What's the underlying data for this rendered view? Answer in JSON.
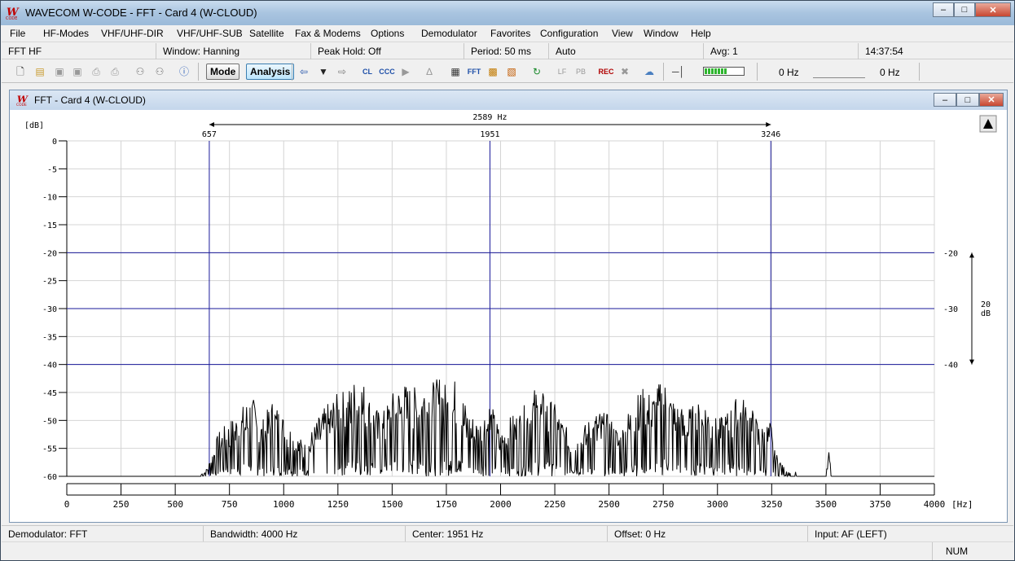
{
  "window": {
    "title": "WAVECOM W-CODE - FFT  - Card 4 (W-CLOUD)",
    "logo_text": "W CODE"
  },
  "menu": [
    "File",
    "HF-Modes",
    "VHF/UHF-DIR",
    "VHF/UHF-SUB",
    "Satellite",
    "Fax & Modems",
    "Options",
    "Demodulator",
    "Favorites",
    "Configuration",
    "View",
    "Window",
    "Help"
  ],
  "infobar": {
    "mode": "FFT HF",
    "window": "Window: Hanning",
    "peak_hold": "Peak Hold: Off",
    "period": "Period: 50 ms",
    "auto": "Auto",
    "avg": "Avg: 1",
    "time": "14:37:54"
  },
  "toolbar": {
    "mode_label": "Mode",
    "analysis_label": "Analysis",
    "cl_label": "CL",
    "ccc_label": "CCC",
    "fft_label": "FFT",
    "lf_label": "LF",
    "pb_label": "PB",
    "rec_label": "REC",
    "freq_left": "0 Hz",
    "freq_right": "0 Hz",
    "icons": [
      "new-file-icon",
      "open-folder-icon",
      "save-icon",
      "save-all-icon",
      "print-icon",
      "print-preview-icon",
      "binoculars-icon",
      "find-next-icon",
      "help-icon",
      "back-arrow-icon",
      "dropdown-arrow-icon",
      "forward-arrow-icon",
      "play-icon",
      "antenna-icon",
      "chip-icon",
      "grid-icon",
      "pattern-icon",
      "refresh-icon",
      "speaker-mute-icon",
      "cloud-icon",
      "slider-icon",
      "level-meter-icon"
    ]
  },
  "child_window": {
    "title": "FFT  - Card 4 (W-CLOUD)"
  },
  "chart_data": {
    "type": "line",
    "ylabel": "[dB]",
    "xlabel": "[Hz]",
    "xlim": [
      0,
      4000
    ],
    "ylim": [
      -60,
      0
    ],
    "x_ticks": [
      0,
      250,
      500,
      750,
      1000,
      1250,
      1500,
      1750,
      2000,
      2250,
      2500,
      2750,
      3000,
      3250,
      3500,
      3750,
      4000
    ],
    "y_ticks": [
      0,
      -5,
      -10,
      -15,
      -20,
      -25,
      -30,
      -35,
      -40,
      -45,
      -50,
      -55,
      -60
    ],
    "markers": {
      "left": 657,
      "left_label": "657",
      "center": 1951,
      "center_label": "1951",
      "right": 3246,
      "right_label": "3246",
      "span_label": "2589 Hz"
    },
    "ref_lines": [
      -20,
      -30,
      -40
    ],
    "right_scale": {
      "labels": [
        "-20",
        "-30",
        "-40"
      ],
      "span_label": "20",
      "unit": "dB"
    },
    "spectrum": {
      "description_points": [
        [
          0,
          -60
        ],
        [
          600,
          -60
        ],
        [
          640,
          -59
        ],
        [
          660,
          -57
        ],
        [
          700,
          -52
        ],
        [
          750,
          -50
        ],
        [
          800,
          -48
        ],
        [
          850,
          -45
        ],
        [
          900,
          -50
        ],
        [
          950,
          -46
        ],
        [
          1000,
          -49
        ],
        [
          1050,
          -52
        ],
        [
          1100,
          -54
        ],
        [
          1150,
          -50
        ],
        [
          1200,
          -47
        ],
        [
          1250,
          -45
        ],
        [
          1300,
          -44
        ],
        [
          1350,
          -41
        ],
        [
          1400,
          -46
        ],
        [
          1450,
          -49
        ],
        [
          1500,
          -45
        ],
        [
          1550,
          -43
        ],
        [
          1600,
          -44
        ],
        [
          1650,
          -42
        ],
        [
          1700,
          -43
        ],
        [
          1730,
          -41
        ],
        [
          1750,
          -44
        ],
        [
          1800,
          -42
        ],
        [
          1850,
          -48
        ],
        [
          1900,
          -50
        ],
        [
          1950,
          -46
        ],
        [
          2000,
          -52
        ],
        [
          2050,
          -49
        ],
        [
          2100,
          -48
        ],
        [
          2150,
          -44
        ],
        [
          2200,
          -45
        ],
        [
          2250,
          -47
        ],
        [
          2300,
          -51
        ],
        [
          2350,
          -53
        ],
        [
          2400,
          -50
        ],
        [
          2450,
          -48
        ],
        [
          2500,
          -49
        ],
        [
          2550,
          -52
        ],
        [
          2600,
          -47
        ],
        [
          2650,
          -44
        ],
        [
          2700,
          -45
        ],
        [
          2750,
          -42
        ],
        [
          2800,
          -46
        ],
        [
          2850,
          -48
        ],
        [
          2900,
          -47
        ],
        [
          2950,
          -46
        ],
        [
          3000,
          -50
        ],
        [
          3050,
          -48
        ],
        [
          3100,
          -45
        ],
        [
          3150,
          -47
        ],
        [
          3200,
          -51
        ],
        [
          3246,
          -50
        ],
        [
          3260,
          -55
        ],
        [
          3300,
          -58
        ],
        [
          3350,
          -60
        ],
        [
          3360,
          -59
        ],
        [
          3370,
          -60
        ],
        [
          3500,
          -60
        ],
        [
          3515,
          -55
        ],
        [
          3525,
          -60
        ],
        [
          4000,
          -60
        ]
      ],
      "floor": -60
    }
  },
  "statusbar": {
    "demodulator": "Demodulator: FFT",
    "bandwidth": "Bandwidth: 4000 Hz",
    "center": "Center: 1951 Hz",
    "offset": "Offset: 0 Hz",
    "input": "Input: AF (LEFT)",
    "num": "NUM"
  }
}
